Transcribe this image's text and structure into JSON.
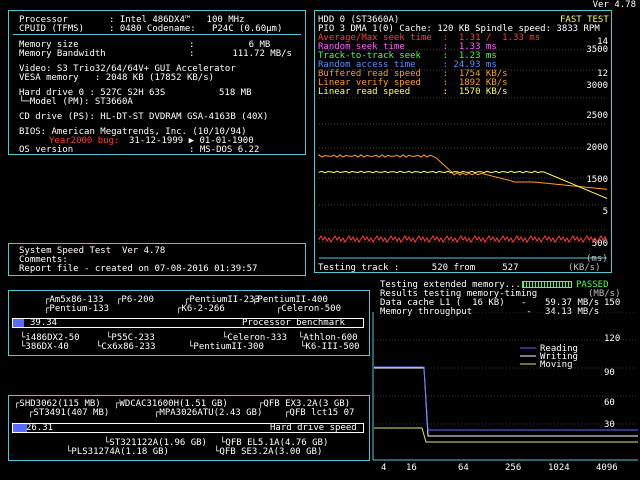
{
  "version": "Ver 4.78",
  "sysinfo": {
    "processor_label": "Processor",
    "processor_value": ": Intel 486DX4™   100 MHz",
    "cpuid_label": "CPUID (TFMS)",
    "cpuid_value": ": 0480 Codename:   P24C (0.60µm)",
    "mem_size_label": "Memory size",
    "mem_size_value": ":          6 MB",
    "mem_bw_label": "Memory Bandwidth",
    "mem_bw_value": ":       111.72 MB/s",
    "video": "Video: S3 Trio32/64/64V+ GUI Accelerator",
    "vesa": "VESA memory   : 2048 KB (17852 KB/s)",
    "hdd_label": "Hard drive 0 : 527C S2H 63S",
    "hdd_size": "518 MB",
    "hdd_model": "└─Model (PM): ST3660A",
    "cd": "CD drive (PS): HL-DT-ST DVDRAM GSA-4163B (40X)",
    "bios": "BIOS: American Megatrends, Inc. (10/10/94)",
    "y2k_label": "Year2000 bug:",
    "y2k_value": "31-12-1999 ▶ 01-01-1900",
    "os_label": "OS version",
    "os_value": ": MS-DOS 6.22"
  },
  "speedtest": {
    "line1": "System Speed Test  Ver 4.78",
    "line2": "Comments:",
    "line3": "Report file - created on 07-08-2016 01:39:57"
  },
  "hdd_test": {
    "title": "HDD 0 (ST3660A)",
    "status": "FAST TEST",
    "pio": "PIO 3 DMA 1(0) Cache: 120 KB Spindle speed: 3833 RPM",
    "rows": [
      {
        "label": "Average/Max seek time  :",
        "value": "  1.31 /  1.33 ms",
        "color": "#ff3a3a"
      },
      {
        "label": "Random seek time       :",
        "value": "  1.33 ms",
        "color": "#ff60ff"
      },
      {
        "label": "Track-to-track seek    :",
        "value": "  1.23 ms",
        "color": "#4cff4c"
      },
      {
        "label": "Random access time     :",
        "value": " 24.93 ms",
        "color": "#5a8cff"
      },
      {
        "label": "Buffered read speed    :",
        "value": "  1754 KB/s",
        "color": "#ff9a2a"
      },
      {
        "label": "Linear verify speed    :",
        "value": "  1892 KB/s",
        "color": "#ff9a2a"
      },
      {
        "label": "Linear read speed      :",
        "value": "  1570 KB/s",
        "color": "#ffff58"
      }
    ],
    "right_ticks": [
      "14",
      "3500",
      "12",
      "3000",
      "2500",
      "2000",
      "1500",
      "5",
      "500"
    ],
    "ms_label": "(ms)",
    "bottom": "Testing track :      520 from     527",
    "unit": "(KB/s)"
  },
  "mem_test": {
    "title": "Testing extended memory...",
    "passed": "PASSED",
    "line2": "Results testing memory-timing",
    "unit": "(MB/s)",
    "l1_label": "Data cache L1 (  16 KB)   -",
    "l1_value": "59.37 MB/s",
    "tp_label": "Memory throughput          -",
    "tp_value": "34.13 MB/s",
    "y_ticks": [
      "150",
      "120",
      "90",
      "60",
      "30"
    ],
    "x_ticks": [
      "4",
      "16",
      "64",
      "256",
      "1024",
      "4096"
    ],
    "legend": [
      {
        "name": "Reading",
        "color": "#5a6cff"
      },
      {
        "name": "Writing",
        "color": "#ffffff"
      },
      {
        "name": "Moving",
        "color": "#e6e65a"
      }
    ]
  },
  "cpu_bench": {
    "labels_top": [
      "Am5x86-133",
      "P6-200",
      "PentiumII-233",
      "PentiumII-400",
      "Pentium-133",
      "K6-2-266",
      "Celeron-500"
    ],
    "labels_bottom": [
      "i486DX2-50",
      "P55C-233",
      "Celeron-333",
      "Athlon-600",
      "386DX-40",
      "Cx6x86-233",
      "PentiumII-300",
      "K6-III-500"
    ],
    "score": "39.34",
    "title": "Processor benchmark",
    "fraction": 0.03
  },
  "hdd_bench": {
    "labels_top": [
      "SHD3062(115 MB)",
      "WDCAC31600H(1.51 GB)",
      "QFB EX3.2A(3 GB)",
      "ST3491(407 MB)",
      "MPA3026ATU(2.43 GB)",
      "QFB lct15 07"
    ],
    "labels_bottom": [
      "ST321122A(1.96 GB)",
      "QFB EL5.1A(4.76 GB)",
      "PLS31274A(1.18 GB)",
      "QFB SE3.2A(3.00 GB)"
    ],
    "score": "26.31",
    "title": "Hard drive speed",
    "fraction": 0.04
  }
}
